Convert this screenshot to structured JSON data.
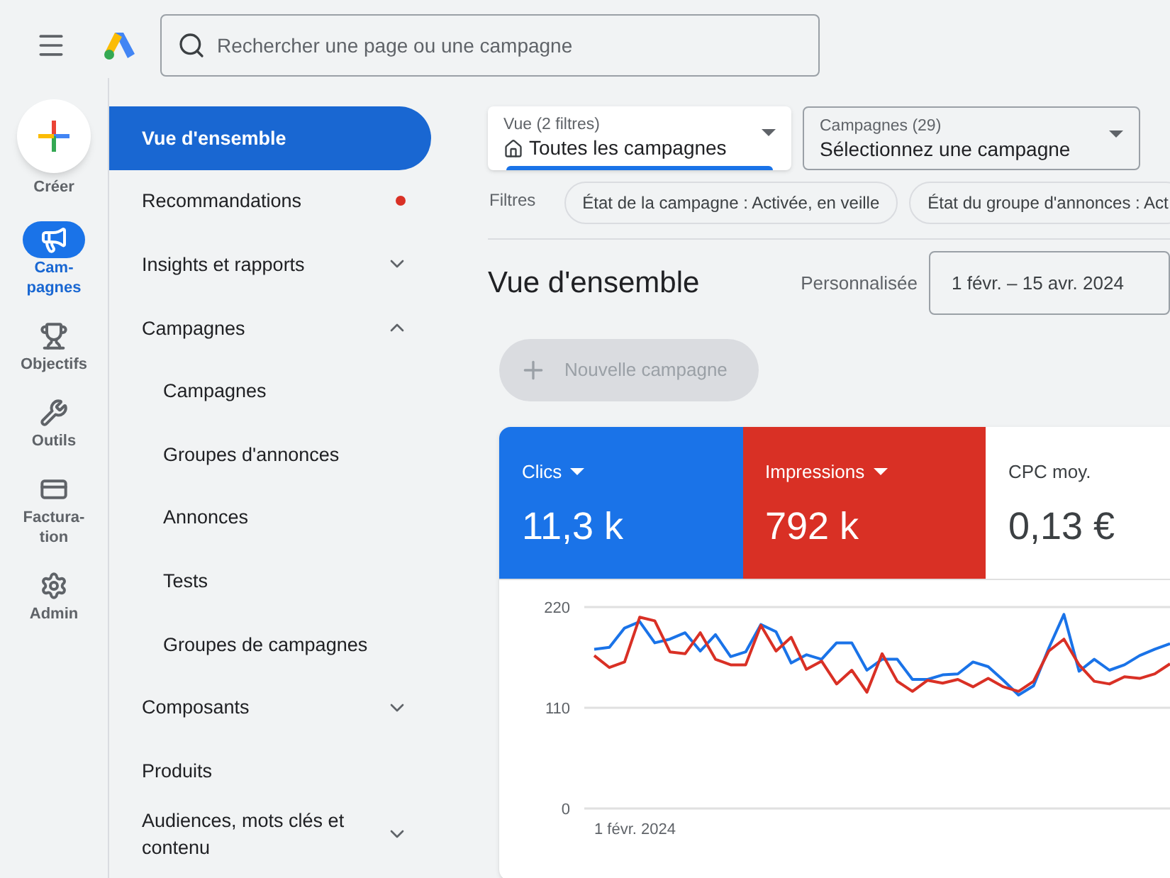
{
  "top_bar": {
    "search": {
      "placeholder": "Rechercher une page ou une campagne"
    }
  },
  "rail": {
    "create": {
      "label": "Créer"
    },
    "items": [
      {
        "kind": "campaigns",
        "label": "Cam-pagnes",
        "selected": true
      },
      {
        "kind": "goals",
        "label": "Objectifs",
        "selected": false
      },
      {
        "kind": "tools",
        "label": "Outils",
        "selected": false
      },
      {
        "kind": "billing",
        "label": "Factura-tion",
        "selected": false
      },
      {
        "kind": "admin",
        "label": "Admin",
        "selected": false
      }
    ]
  },
  "nav": {
    "items": [
      {
        "label": "Vue d'ensemble",
        "selected": true
      },
      {
        "label": "Recommandations",
        "selected": false,
        "alert": true
      },
      {
        "label": "Insights et rapports",
        "selected": false,
        "expanded": false
      },
      {
        "label": "Campagnes",
        "selected": false,
        "expanded": true,
        "children": [
          {
            "label": "Campagnes",
            "selected": false
          },
          {
            "label": "Groupes d'annonces",
            "selected": false
          },
          {
            "label": "Annonces",
            "selected": false
          },
          {
            "label": "Tests",
            "selected": false
          },
          {
            "label": "Groupes de campagnes",
            "selected": false
          }
        ]
      },
      {
        "label": "Composants",
        "selected": false,
        "expanded": false
      },
      {
        "label": "Produits",
        "selected": false
      },
      {
        "label": "Audiences, mots clés et contenu",
        "selected": false,
        "expanded": false
      }
    ]
  },
  "selectors": [
    {
      "label": "Vue (2 filtres)",
      "value": "Toutes les campagnes",
      "focused": true
    },
    {
      "label": "Campagnes (29)",
      "value": "Sélectionnez une campagne",
      "focused": false
    }
  ],
  "filters": {
    "label": "Filtres",
    "chips": [
      "État de la campagne : Activée, en veille",
      "État du groupe d'annonces : Act"
    ]
  },
  "page": {
    "title": "Vue d'ensemble",
    "range_label": "Personnalisée",
    "date_range": "1 févr. – 15 avr. 2024"
  },
  "new_campaign": {
    "label": "Nouvelle campagne",
    "disabled": true
  },
  "metrics": [
    {
      "label": "Clics",
      "value": "11,3 k",
      "selected": true,
      "color": "#1a73e8"
    },
    {
      "label": "Impressions",
      "value": "792 k",
      "selected": true,
      "color": "#d93025"
    },
    {
      "label": "CPC moy.",
      "value": "0,13 €",
      "selected": false
    }
  ],
  "chart": {
    "start_label": "1 févr. 2024",
    "chart_data": {
      "type": "line",
      "ylim": [
        0,
        220
      ],
      "yticks": [
        {
          "value": 0,
          "label": "0"
        },
        {
          "value": 110,
          "label": "110"
        },
        {
          "value": 220,
          "label": "220"
        }
      ],
      "series": [
        {
          "color": "#1a73e8",
          "values": [
            174,
            176,
            197,
            204,
            181,
            185,
            192,
            172,
            190,
            166,
            171,
            201,
            193,
            159,
            168,
            163,
            181,
            181,
            151,
            163,
            163,
            141,
            141,
            146,
            147,
            160,
            155,
            140,
            124,
            134,
            175,
            212,
            150,
            163,
            151,
            157,
            167,
            174,
            180
          ]
        },
        {
          "color": "#d93025",
          "values": [
            167,
            154,
            160,
            209,
            205,
            171,
            169,
            192,
            163,
            157,
            157,
            200,
            172,
            187,
            152,
            161,
            136,
            151,
            127,
            169,
            139,
            128,
            140,
            137,
            141,
            133,
            142,
            133,
            128,
            139,
            172,
            185,
            157,
            139,
            136,
            144,
            142,
            147,
            158
          ]
        }
      ]
    }
  }
}
